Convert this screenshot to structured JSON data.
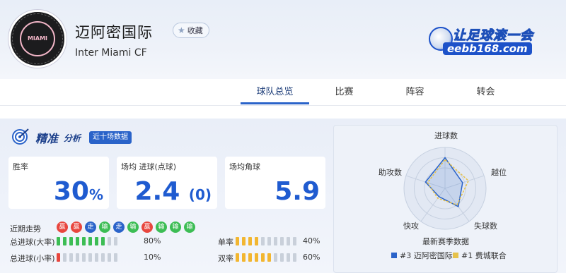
{
  "header": {
    "team_name": "迈阿密国际",
    "team_en": "Inter Miami CF",
    "fav_label": "收藏",
    "logo_text": "MIAMI",
    "brand_top": "让足球滚一会",
    "brand_bottom": "eebb168.com"
  },
  "tabs": [
    {
      "label": "球队总览",
      "active": true
    },
    {
      "label": "比赛",
      "active": false
    },
    {
      "label": "阵容",
      "active": false
    },
    {
      "label": "转会",
      "active": false
    }
  ],
  "analysis": {
    "title": "精准",
    "subtitle": "分析",
    "badge": "近十场数据",
    "cards": [
      {
        "label": "胜率",
        "value": "30",
        "unit": "%"
      },
      {
        "label": "场均 进球(点球)",
        "value": "2.4",
        "extra": "(0)"
      },
      {
        "label": "场均角球",
        "value": "5.9"
      }
    ],
    "recent_label": "近期走势",
    "recent": [
      {
        "text": "赢",
        "type": "win"
      },
      {
        "text": "赢",
        "type": "win"
      },
      {
        "text": "走",
        "type": "draw"
      },
      {
        "text": "输",
        "type": "loss"
      },
      {
        "text": "走",
        "type": "draw"
      },
      {
        "text": "输",
        "type": "loss"
      },
      {
        "text": "赢",
        "type": "win"
      },
      {
        "text": "输",
        "type": "loss"
      },
      {
        "text": "输",
        "type": "loss"
      },
      {
        "text": "输",
        "type": "loss"
      }
    ],
    "bars": [
      {
        "label": "总进球(大率)",
        "pct_text": "80%",
        "filled": 8,
        "color": "#3cbd54"
      },
      {
        "label": "总进球(小率)",
        "pct_text": "10%",
        "filled": 1,
        "color": "#e8463e"
      },
      {
        "label": "单率",
        "pct_text": "40%",
        "filled": 4,
        "color": "#f2b630"
      },
      {
        "label": "双率",
        "pct_text": "60%",
        "filled": 6,
        "color": "#f2b630"
      }
    ],
    "colors": {
      "win": "#e8463e",
      "draw": "#2a63c9",
      "loss": "#3cbd54",
      "bar_empty": "#c9d0da"
    }
  },
  "radar": {
    "axes": [
      "进球数",
      "越位",
      "失球数",
      "快攻",
      "助攻数"
    ],
    "caption": "最新赛季数据",
    "legend": [
      {
        "label": "#3 迈阿密国际",
        "color": "#2a63c9"
      },
      {
        "label": "#1 费城联合",
        "color": "#e6c24b"
      }
    ],
    "series": [
      {
        "name": "#3 迈阿密国际",
        "values": [
          0.75,
          0.45,
          0.55,
          0.25,
          0.5
        ]
      },
      {
        "name": "#1 费城联合",
        "values": [
          0.7,
          0.6,
          0.5,
          0.3,
          0.45
        ]
      }
    ]
  }
}
